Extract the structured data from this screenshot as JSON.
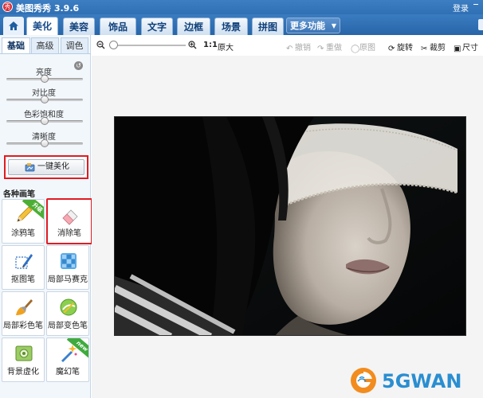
{
  "app": {
    "title": "美图秀秀 3.9.6",
    "logo_char": "秀",
    "login": "登录"
  },
  "nav": {
    "tabs": [
      "美化",
      "美容",
      "饰品",
      "文字",
      "边框",
      "场景",
      "拼图"
    ],
    "more": "更多功能",
    "active_tab": "美化"
  },
  "panel": {
    "subtabs": [
      "基础",
      "高级",
      "调色"
    ],
    "active_subtab": "基础",
    "sliders": [
      {
        "label": "亮度",
        "value": 0.5
      },
      {
        "label": "对比度",
        "value": 0.5
      },
      {
        "label": "色彩饱和度",
        "value": 0.5
      },
      {
        "label": "清晰度",
        "value": 0.5
      }
    ],
    "one_click": "一键美化",
    "brush_title": "各种画笔",
    "tools": [
      {
        "label": "涂鸦笔",
        "icon": "pencil-icon",
        "badge": "升级"
      },
      {
        "label": "消除笔",
        "icon": "eraser-icon",
        "badge": ""
      },
      {
        "label": "抠图笔",
        "icon": "cutout-pen-icon",
        "badge": ""
      },
      {
        "label": "局部马赛克",
        "icon": "mosaic-icon",
        "badge": ""
      },
      {
        "label": "局部彩色笔",
        "icon": "color-brush-icon",
        "badge": ""
      },
      {
        "label": "局部变色笔",
        "icon": "recolor-brush-icon",
        "badge": ""
      },
      {
        "label": "背景虚化",
        "icon": "blur-background-icon",
        "badge": ""
      },
      {
        "label": "魔幻笔",
        "icon": "magic-pen-icon",
        "badge": "new"
      }
    ]
  },
  "toolbar": {
    "zoom_level": 0,
    "ratio": "1:1",
    "original": "原大",
    "undo": "撤销",
    "redo": "重做",
    "original_image": "原图",
    "rotate": "旋转",
    "crop": "裁剪",
    "size": "尺寸"
  },
  "watermark": {
    "text": "5GWAN"
  },
  "colors": {
    "accent": "#2f6fb4",
    "highlight_box": "#e11b22",
    "badge_green": "#4cae35",
    "watermark_blue": "#2a8ed1",
    "watermark_orange": "#f28c1e"
  }
}
